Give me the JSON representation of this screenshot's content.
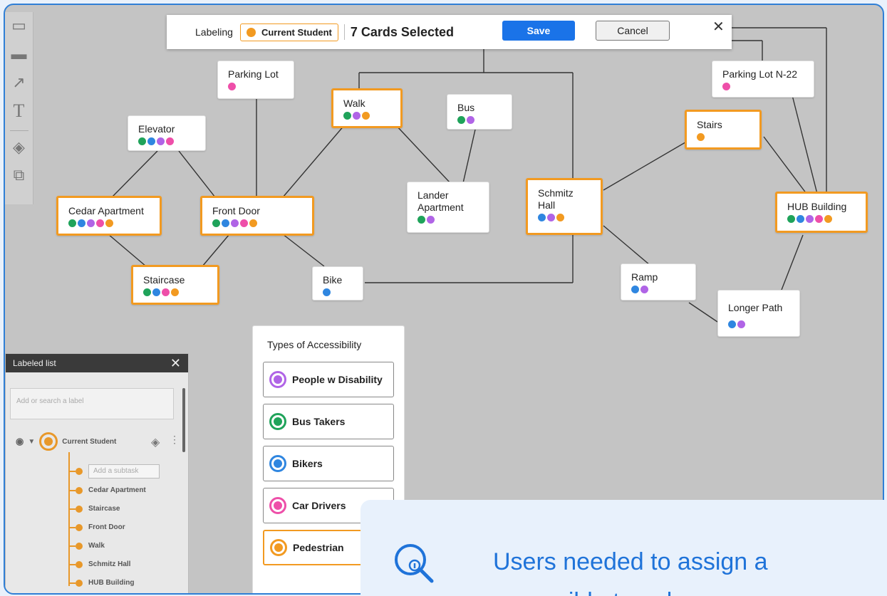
{
  "topbar": {
    "labeling_label": "Labeling",
    "chip_label": "Current Student",
    "chip_color": "#f29a21",
    "selected_count_text": "7 Cards Selected",
    "save_label": "Save",
    "cancel_label": "Cancel",
    "close_glyph": "✕"
  },
  "toolbar": {
    "tools": [
      "sticky-note-icon",
      "card-icon",
      "connector-arrow-icon",
      "text-tool-icon",
      "tag-icon",
      "present-icon"
    ]
  },
  "colors": {
    "green": "#1fa35a",
    "blue": "#2f86e0",
    "purple": "#b064e6",
    "pink": "#ee4fa9",
    "orange": "#f29a21"
  },
  "cards": {
    "parking_lot": {
      "title": "Parking Lot",
      "dots": [
        "pink"
      ]
    },
    "walk": {
      "title": "Walk",
      "dots": [
        "green",
        "purple",
        "orange"
      ]
    },
    "bus": {
      "title": "Bus",
      "dots": [
        "green",
        "purple"
      ]
    },
    "parking_n22": {
      "title": "Parking Lot N-22",
      "dots": [
        "pink"
      ]
    },
    "elevator": {
      "title": "Elevator",
      "dots": [
        "green",
        "blue",
        "purple",
        "pink"
      ]
    },
    "stairs": {
      "title": "Stairs",
      "dots": [
        "orange"
      ]
    },
    "cedar": {
      "title": "Cedar Apartment",
      "dots": [
        "green",
        "blue",
        "purple",
        "pink",
        "orange"
      ]
    },
    "front_door": {
      "title": "Front Door",
      "dots": [
        "green",
        "blue",
        "purple",
        "pink",
        "orange"
      ]
    },
    "lander": {
      "title": "Lander\nApartment",
      "dots": [
        "green",
        "purple"
      ]
    },
    "schmitz": {
      "title": "Schmitz\nHall",
      "dots": [
        "blue",
        "purple",
        "orange"
      ]
    },
    "hub": {
      "title": "HUB Building",
      "dots": [
        "green",
        "blue",
        "purple",
        "pink",
        "orange"
      ]
    },
    "staircase": {
      "title": "Staircase",
      "dots": [
        "green",
        "blue",
        "pink",
        "orange"
      ]
    },
    "bike": {
      "title": "Bike",
      "dots": [
        "blue"
      ]
    },
    "ramp": {
      "title": "Ramp",
      "dots": [
        "blue",
        "purple"
      ]
    },
    "longer_path": {
      "title": "Longer Path",
      "dots": [
        "blue",
        "purple"
      ]
    }
  },
  "accessibility": {
    "title": "Types of Accessibility",
    "items": [
      {
        "label": "People w Disability",
        "color": "#b064e6"
      },
      {
        "label": "Bus Takers",
        "color": "#1fa35a"
      },
      {
        "label": "Bikers",
        "color": "#2f86e0"
      },
      {
        "label": "Car Drivers",
        "color": "#ee4fa9"
      },
      {
        "label": "Pedestrian",
        "color": "#f29a21"
      }
    ]
  },
  "labeled_list": {
    "title": "Labeled list",
    "search_placeholder": "Add or search a label",
    "root_label": "Current Student",
    "subtask_placeholder": "Add a subtask",
    "children": [
      "Cedar Apartment",
      "Staircase",
      "Front Door",
      "Walk",
      "Schmitz Hall",
      "HUB Building"
    ]
  },
  "callout": {
    "line1": "Users needed to assign a",
    "line2": "accessible travel"
  }
}
